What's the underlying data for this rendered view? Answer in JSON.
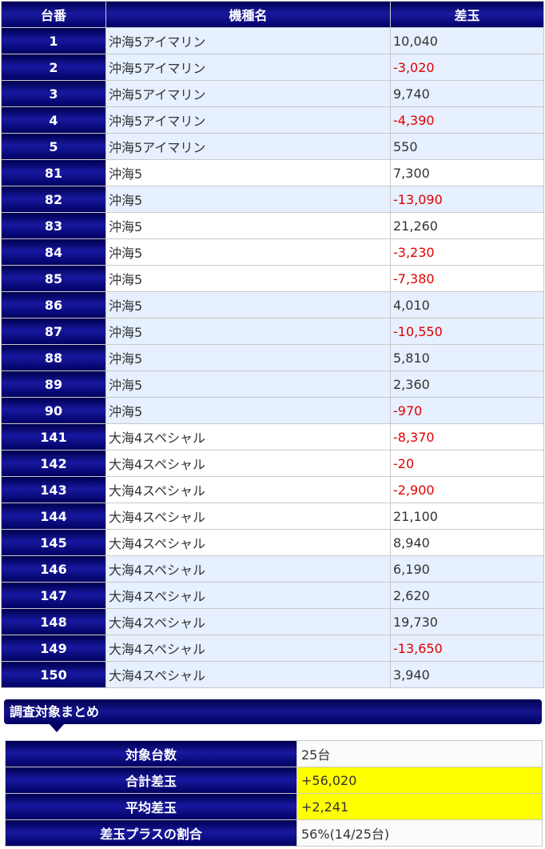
{
  "table": {
    "headers": {
      "number": "台番",
      "model": "機種名",
      "diff": "差玉"
    },
    "rows": [
      {
        "number": "1",
        "model": "沖海5アイマリン",
        "diff": "10,040",
        "negative": false,
        "shade": "blue"
      },
      {
        "number": "2",
        "model": "沖海5アイマリン",
        "diff": "-3,020",
        "negative": true,
        "shade": "blue"
      },
      {
        "number": "3",
        "model": "沖海5アイマリン",
        "diff": "9,740",
        "negative": false,
        "shade": "blue"
      },
      {
        "number": "4",
        "model": "沖海5アイマリン",
        "diff": "-4,390",
        "negative": true,
        "shade": "blue"
      },
      {
        "number": "5",
        "model": "沖海5アイマリン",
        "diff": "550",
        "negative": false,
        "shade": "blue"
      },
      {
        "number": "81",
        "model": "沖海5",
        "diff": "7,300",
        "negative": false,
        "shade": "white"
      },
      {
        "number": "82",
        "model": "沖海5",
        "diff": "-13,090",
        "negative": true,
        "shade": "blue"
      },
      {
        "number": "83",
        "model": "沖海5",
        "diff": "21,260",
        "negative": false,
        "shade": "white"
      },
      {
        "number": "84",
        "model": "沖海5",
        "diff": "-3,230",
        "negative": true,
        "shade": "white"
      },
      {
        "number": "85",
        "model": "沖海5",
        "diff": "-7,380",
        "negative": true,
        "shade": "white"
      },
      {
        "number": "86",
        "model": "沖海5",
        "diff": "4,010",
        "negative": false,
        "shade": "blue"
      },
      {
        "number": "87",
        "model": "沖海5",
        "diff": "-10,550",
        "negative": true,
        "shade": "blue"
      },
      {
        "number": "88",
        "model": "沖海5",
        "diff": "5,810",
        "negative": false,
        "shade": "blue"
      },
      {
        "number": "89",
        "model": "沖海5",
        "diff": "2,360",
        "negative": false,
        "shade": "blue"
      },
      {
        "number": "90",
        "model": "沖海5",
        "diff": "-970",
        "negative": true,
        "shade": "blue"
      },
      {
        "number": "141",
        "model": "大海4スペシャル",
        "diff": "-8,370",
        "negative": true,
        "shade": "white"
      },
      {
        "number": "142",
        "model": "大海4スペシャル",
        "diff": "-20",
        "negative": true,
        "shade": "white"
      },
      {
        "number": "143",
        "model": "大海4スペシャル",
        "diff": "-2,900",
        "negative": true,
        "shade": "white"
      },
      {
        "number": "144",
        "model": "大海4スペシャル",
        "diff": "21,100",
        "negative": false,
        "shade": "white"
      },
      {
        "number": "145",
        "model": "大海4スペシャル",
        "diff": "8,940",
        "negative": false,
        "shade": "white"
      },
      {
        "number": "146",
        "model": "大海4スペシャル",
        "diff": "6,190",
        "negative": false,
        "shade": "blue"
      },
      {
        "number": "147",
        "model": "大海4スペシャル",
        "diff": "2,620",
        "negative": false,
        "shade": "blue"
      },
      {
        "number": "148",
        "model": "大海4スペシャル",
        "diff": "19,730",
        "negative": false,
        "shade": "blue"
      },
      {
        "number": "149",
        "model": "大海4スペシャル",
        "diff": "-13,650",
        "negative": true,
        "shade": "blue"
      },
      {
        "number": "150",
        "model": "大海4スペシャル",
        "diff": "3,940",
        "negative": false,
        "shade": "blue"
      }
    ]
  },
  "summary": {
    "title": "調査対象まとめ",
    "rows": [
      {
        "label": "対象台数",
        "value": "25台",
        "highlight": false
      },
      {
        "label": "合計差玉",
        "value": "+56,020",
        "highlight": true
      },
      {
        "label": "平均差玉",
        "value": "+2,241",
        "highlight": true
      },
      {
        "label": "差玉プラスの割合",
        "value": "56%(14/25台)",
        "highlight": false
      }
    ]
  },
  "colors": {
    "header_navy": "#000066",
    "row_blue": "#e6f0ff",
    "negative_red": "#e00000",
    "highlight_yellow": "#ffff00"
  }
}
